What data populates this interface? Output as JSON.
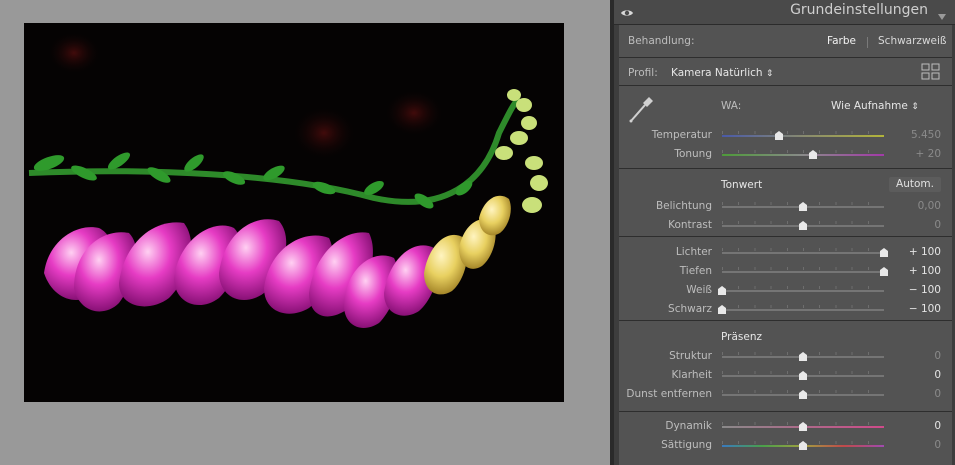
{
  "panel": {
    "title": "Grundeinstellungen",
    "icons": {
      "visibility": "eye-icon",
      "collapse": "triangle-down-icon",
      "profile_browser": "grid-icon",
      "wb_picker": "eyedropper-icon"
    }
  },
  "treatment": {
    "label": "Behandlung:",
    "options": [
      "Farbe",
      "Schwarzweiß"
    ],
    "selected": "Farbe"
  },
  "profile": {
    "label": "Profil:",
    "value": "Kamera Natürlich"
  },
  "white_balance": {
    "label": "WA:",
    "value": "Wie Aufnahme",
    "sliders": [
      {
        "label": "Temperatur",
        "value": "5.450",
        "level": 0.35
      },
      {
        "label": "Tonung",
        "value": "+ 20",
        "level": 0.56
      }
    ]
  },
  "tone": {
    "header": "Tonwert",
    "auto_button": "Autom.",
    "group1": [
      {
        "label": "Belichtung",
        "value": "0,00",
        "level": 0.5
      },
      {
        "label": "Kontrast",
        "value": "0",
        "level": 0.5
      }
    ],
    "group2": [
      {
        "label": "Lichter",
        "value": "+ 100",
        "level": 1.0
      },
      {
        "label": "Tiefen",
        "value": "+ 100",
        "level": 1.0
      },
      {
        "label": "Weiß",
        "value": "− 100",
        "level": 0.0
      },
      {
        "label": "Schwarz",
        "value": "− 100",
        "level": 0.0
      }
    ]
  },
  "presence": {
    "header": "Präsenz",
    "group1": [
      {
        "label": "Struktur",
        "value": "0",
        "level": 0.5
      },
      {
        "label": "Klarheit",
        "value": "0",
        "level": 0.5
      },
      {
        "label": "Dunst entfernen",
        "value": "0",
        "level": 0.5
      }
    ],
    "group2": [
      {
        "label": "Dynamik",
        "value": "0",
        "level": 0.5
      },
      {
        "label": "Sättigung",
        "value": "0",
        "level": 0.5
      }
    ]
  },
  "colors": {
    "panel_bg": "#535353",
    "header_bg": "#4a4a4a",
    "canvas_bg": "#999999"
  }
}
